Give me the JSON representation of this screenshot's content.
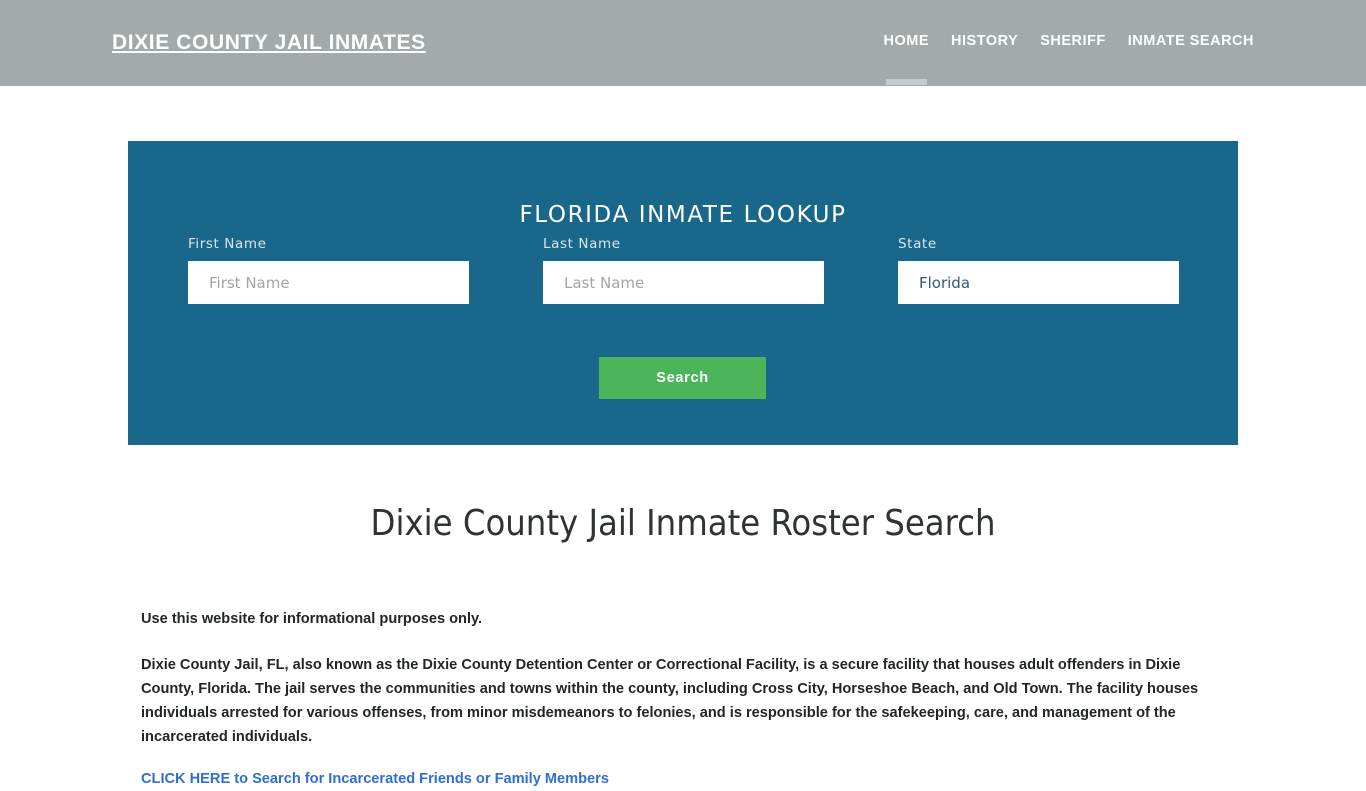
{
  "header": {
    "brand": "DIXIE COUNTY JAIL INMATES",
    "nav": [
      {
        "label": "HOME",
        "active": true
      },
      {
        "label": "HISTORY",
        "active": false
      },
      {
        "label": "SHERIFF",
        "active": false
      },
      {
        "label": "INMATE SEARCH",
        "active": false
      }
    ]
  },
  "search_panel": {
    "title": "FLORIDA INMATE LOOKUP",
    "fields": {
      "first_name": {
        "label": "First Name",
        "placeholder": "First Name",
        "value": ""
      },
      "last_name": {
        "label": "Last Name",
        "placeholder": "Last Name",
        "value": ""
      },
      "state": {
        "label": "State",
        "placeholder": "State",
        "value": "Florida"
      }
    },
    "submit_label": "Search",
    "accent_color": "#19688c",
    "button_color": "#4cb559"
  },
  "main": {
    "heading": "Dixie County Jail Inmate Roster Search",
    "lead": "Use this website for informational purposes only.",
    "body": "Dixie County Jail, FL, also known as the Dixie County Detention Center or Correctional Facility, is a secure facility that houses adult offenders in Dixie County, Florida. The jail serves the communities and towns within the county, including Cross City, Horseshoe Beach, and Old Town. The facility houses individuals arrested for various offenses, from minor misdemeanors to felonies, and is responsible for the safekeeping, care, and management of the incarcerated individuals.",
    "cta_link": "CLICK HERE to Search for Incarcerated Friends or Family Members",
    "link_color": "#2f6fd0"
  }
}
